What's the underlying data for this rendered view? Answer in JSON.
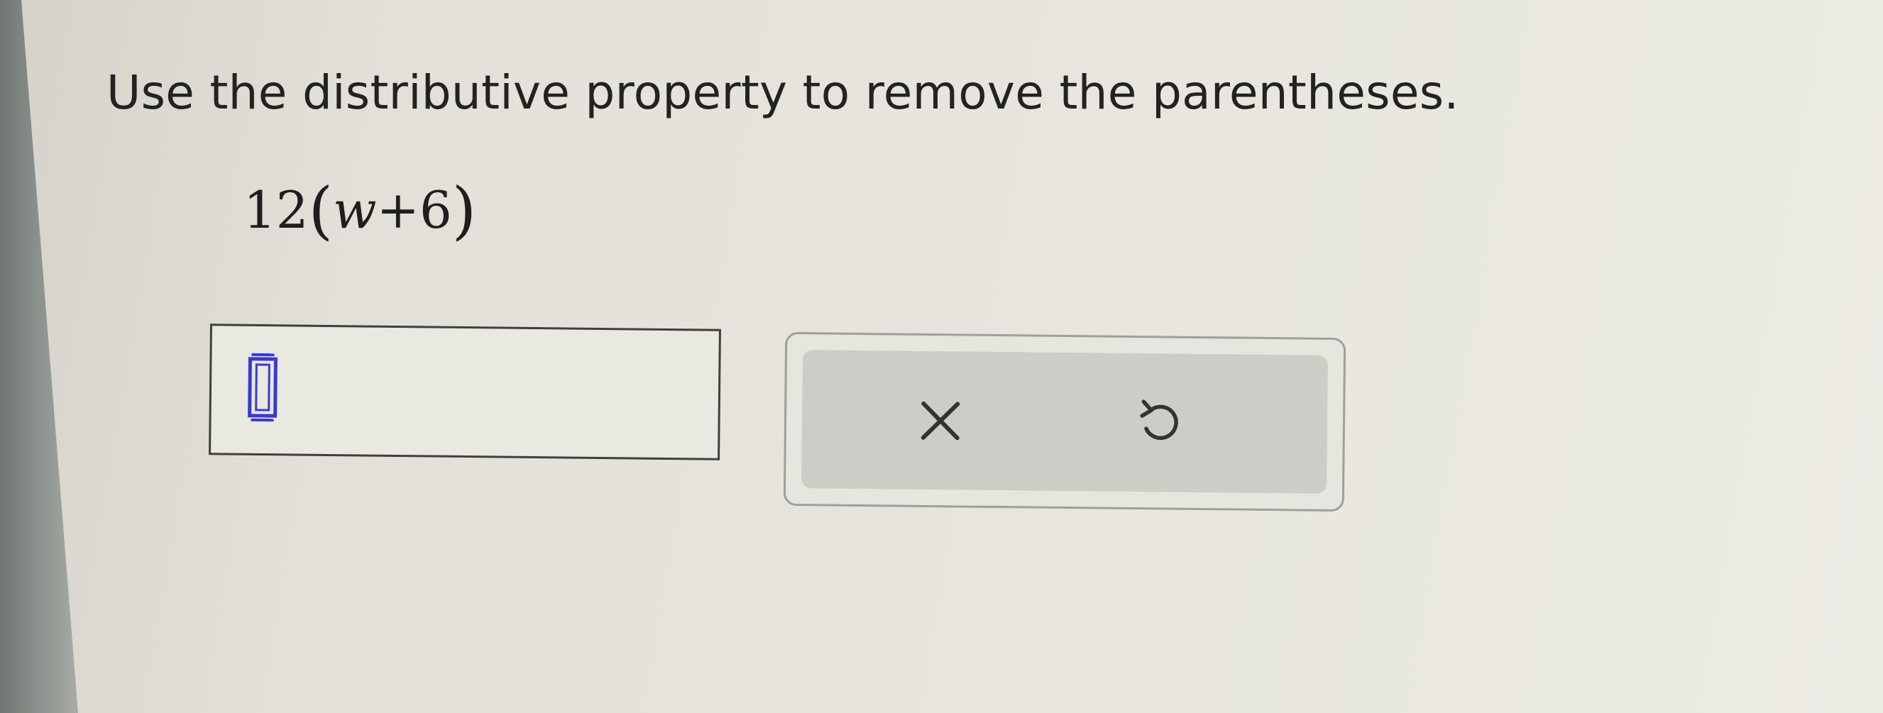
{
  "question": {
    "prompt": "Use the distributive property to remove the parentheses.",
    "expression": {
      "coefficient": "12",
      "open_paren": "(",
      "variable": "w",
      "operator": "+",
      "constant": "6",
      "close_paren": ")"
    }
  },
  "answer": {
    "value": "",
    "template_icon": "empty-box-template-icon"
  },
  "actions": {
    "clear_icon": "x-icon",
    "undo_icon": "undo-icon"
  },
  "colors": {
    "template_icon": "#3a3acd",
    "text": "#222222",
    "panel": "#cdcdc8"
  }
}
